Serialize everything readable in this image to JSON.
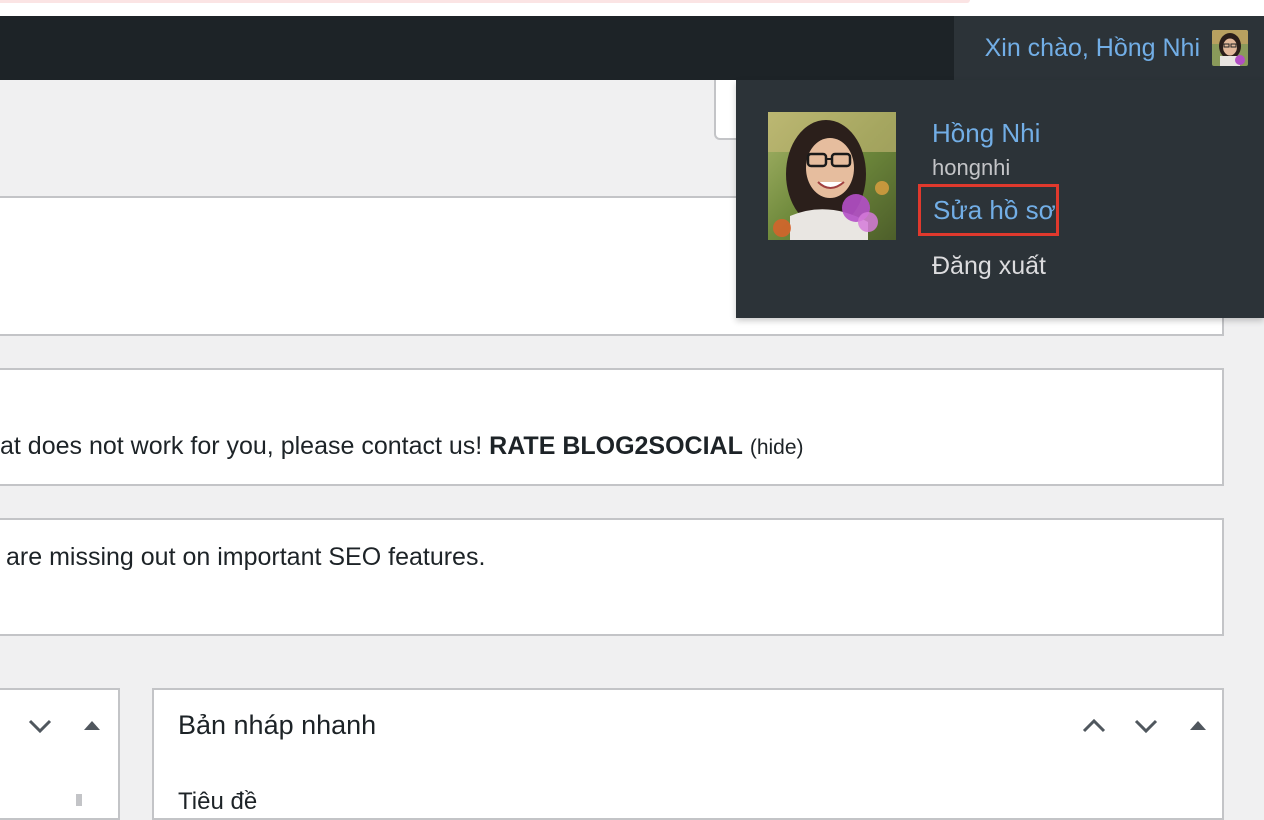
{
  "admin_bar": {
    "greeting": "Xin chào, Hồng Nhi",
    "avatar_icon": "user-avatar-icon"
  },
  "user_menu": {
    "display_name": "Hồng Nhi",
    "username": "hongnhi",
    "edit_profile": "Sửa hồ sơ",
    "logout": "Đăng xuất",
    "highlight_color": "#e0392d"
  },
  "notices": {
    "rate_text": "at does not work for you, please contact us!",
    "rate_link": "RATE BLOG2SOCIAL",
    "hide_link": "(hide)",
    "seo_text": "are missing out on important SEO features."
  },
  "quick_draft": {
    "title": "Bản nháp nhanh",
    "field_title_label": "Tiêu đề"
  },
  "colors": {
    "admin_bar_bg": "#1d2327",
    "menu_bg": "#2c3338",
    "link_blue": "#72aee6",
    "page_bg": "#f0f0f1"
  }
}
